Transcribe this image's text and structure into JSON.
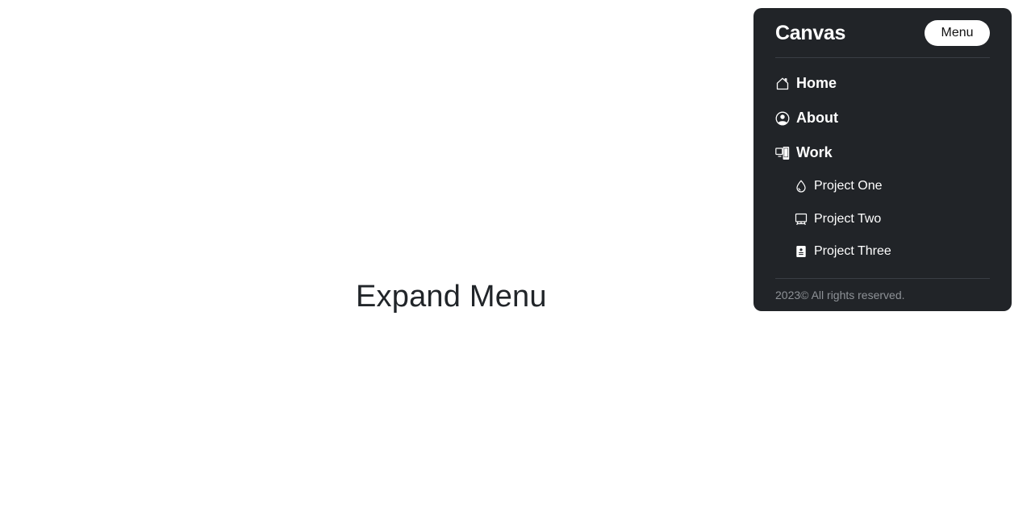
{
  "main": {
    "title": "Expand Menu"
  },
  "menu": {
    "brand": "Canvas",
    "toggle_label": "Menu",
    "items": [
      {
        "label": "Home",
        "icon": "house-icon"
      },
      {
        "label": "About",
        "icon": "person-circle-icon"
      },
      {
        "label": "Work",
        "icon": "devices-icon"
      }
    ],
    "subitems": [
      {
        "label": "Project One",
        "icon": "droplet-icon"
      },
      {
        "label": "Project Two",
        "icon": "easel-icon"
      },
      {
        "label": "Project Three",
        "icon": "file-person-icon"
      }
    ],
    "footer": "2023© All rights reserved."
  },
  "colors": {
    "panel_bg": "#212428",
    "text": "#ffffff",
    "muted": "#8e9297",
    "page_text": "#212529"
  }
}
